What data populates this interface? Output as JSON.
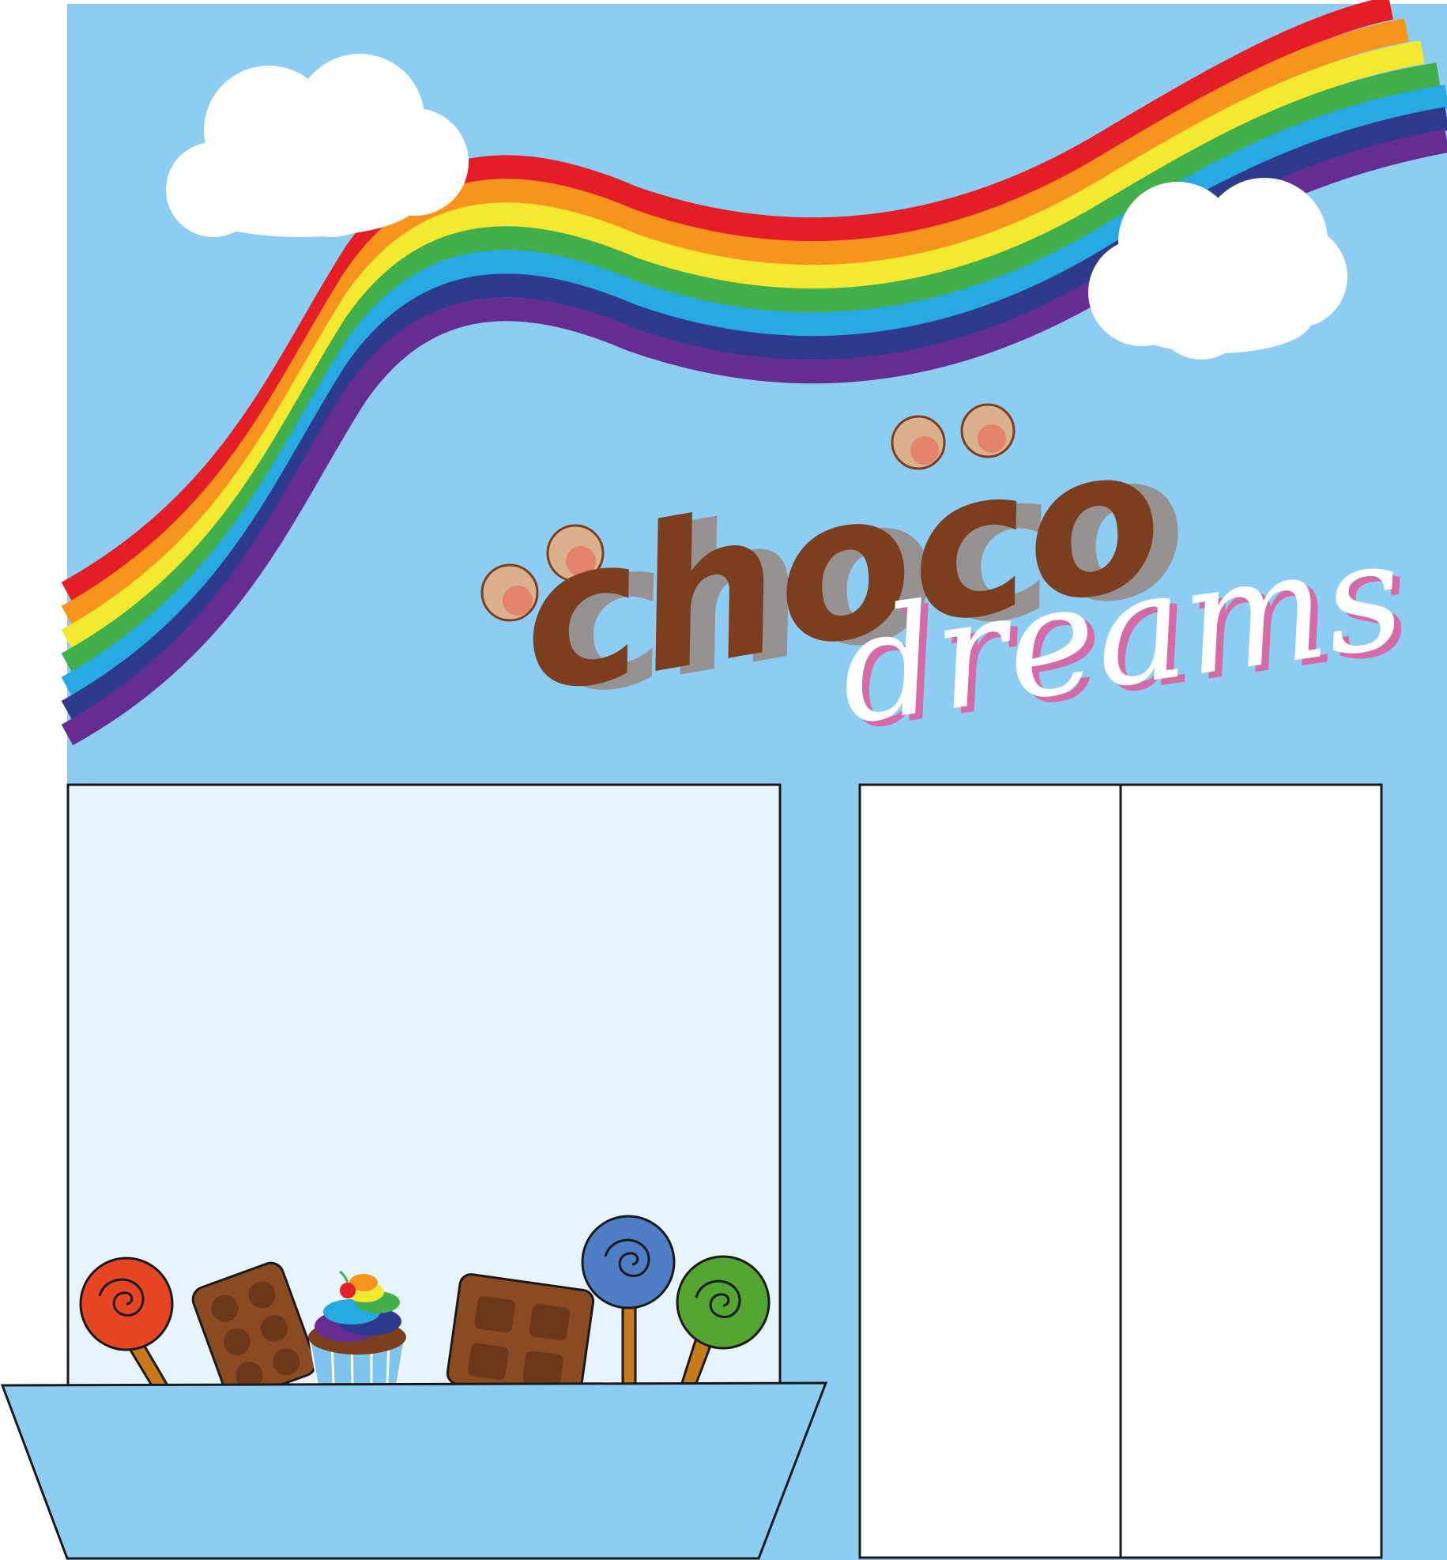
{
  "storefront": {
    "sign": {
      "line1": "choco",
      "line2": "dreams"
    }
  },
  "colors": {
    "sky": "#8ecdf3",
    "window_glass": "#e7f4fc",
    "door": "#ffffff",
    "outline": "#1a1a1a",
    "planter": "#8ecdf3",
    "chocolate": "#7b3f1f",
    "chocolate_shadow": "#9b7f72",
    "dreams_text": "#ffffff",
    "dreams_shadow": "#d46aa6",
    "rainbow": [
      "#e31e25",
      "#f7941d",
      "#f5e831",
      "#42b04a",
      "#25a9e0",
      "#2e3b8c",
      "#662d91"
    ]
  },
  "icons": {
    "clouds": [
      "cloud-icon",
      "cloud-icon"
    ],
    "bear_ears": [
      "bear-ear-icon",
      "bear-ear-icon",
      "bear-ear-icon",
      "bear-ear-icon"
    ],
    "window_display": [
      "lollipop-red-icon",
      "chocolate-bar-icon",
      "cupcake-icon",
      "chocolate-bar-icon",
      "lollipop-blue-icon",
      "lollipop-green-icon"
    ]
  }
}
